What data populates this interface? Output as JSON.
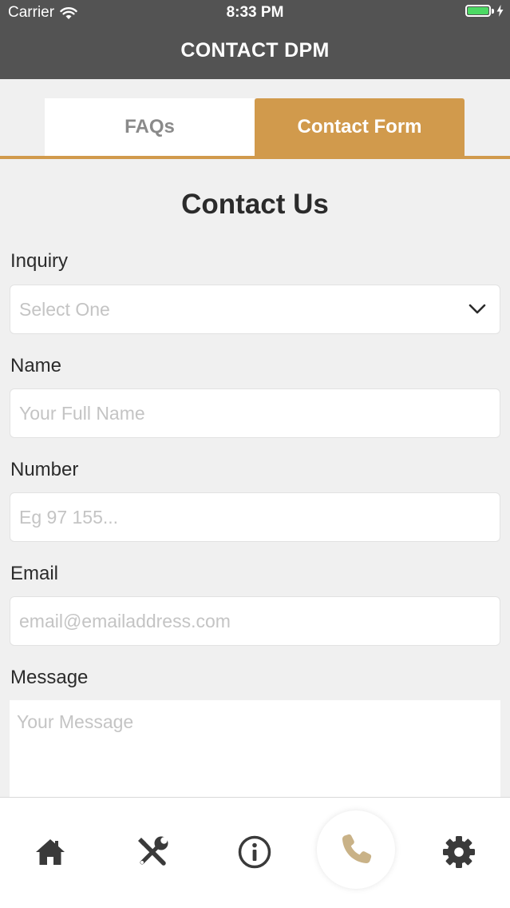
{
  "status_bar": {
    "carrier": "Carrier",
    "time": "8:33 PM",
    "battery_color": "#4cd964"
  },
  "header": {
    "title": "CONTACT DPM",
    "background": "#535353"
  },
  "tabs": {
    "items": [
      {
        "label": "FAQs",
        "selected": false
      },
      {
        "label": "Contact Form",
        "selected": true
      }
    ],
    "accent_color": "#d19a4c"
  },
  "form": {
    "heading": "Contact Us",
    "inquiry": {
      "label": "Inquiry",
      "selected_value": "Select One"
    },
    "name": {
      "label": "Name",
      "placeholder": "Your Full Name",
      "value": ""
    },
    "number": {
      "label": "Number",
      "placeholder": "Eg 97 155...",
      "value": ""
    },
    "email": {
      "label": "Email",
      "placeholder": "email@emailaddress.com",
      "value": ""
    },
    "message": {
      "label": "Message",
      "placeholder": "Your Message",
      "value": ""
    }
  },
  "bottom_nav": {
    "items": [
      {
        "icon": "home-icon"
      },
      {
        "icon": "tools-icon"
      },
      {
        "icon": "info-icon"
      },
      {
        "icon": "phone-icon",
        "active": true
      },
      {
        "icon": "gear-icon"
      }
    ],
    "icon_color": "#3a3a3a",
    "active_icon_color": "#c9b287"
  }
}
